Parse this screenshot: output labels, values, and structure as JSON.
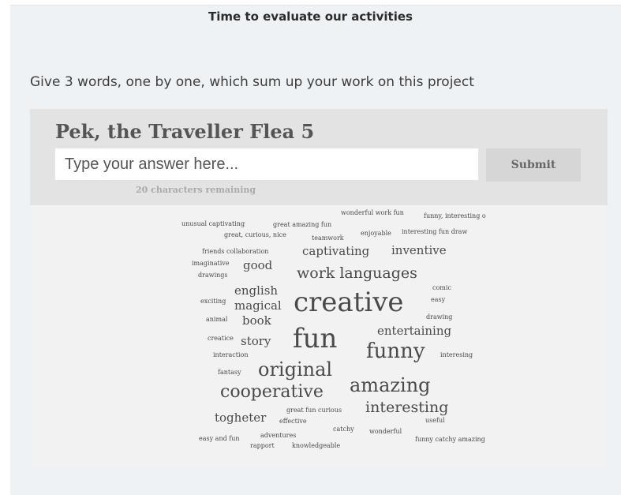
{
  "page": {
    "title": "Time to evaluate our activities"
  },
  "instruction": "Give 3 words, one by one, which sum up your work on this project",
  "card": {
    "title": "Pek, the Traveller Flea 5",
    "input_placeholder": "Type your answer here...",
    "submit_label": "Submit",
    "remaining_text": "20 characters remaining"
  },
  "word_cloud": [
    "unusual captivating",
    "great amazing fun",
    "wonderful work fun",
    "funny, interesting o",
    "great, curious, nice",
    "teamwork",
    "enjoyable",
    "interesting fun draw",
    "friends collaboration",
    "captivating",
    "inventive",
    "imaginative",
    "good",
    "drawings",
    "work languages",
    "comic",
    "english",
    "easy",
    "exciting",
    "magical",
    "creative",
    "animal",
    "book",
    "drawing",
    "entertaining",
    "creatice",
    "story",
    "fun",
    "interaction",
    "funny",
    "interesing",
    "fantasy",
    "original",
    "cooperative",
    "amazing",
    "great fun curious",
    "interesting",
    "togheter",
    "effective",
    "useful",
    "catchy",
    "wonderful",
    "easy and fun",
    "adventures",
    "funny catchy amazing",
    "rapport",
    "knowledgeable"
  ]
}
